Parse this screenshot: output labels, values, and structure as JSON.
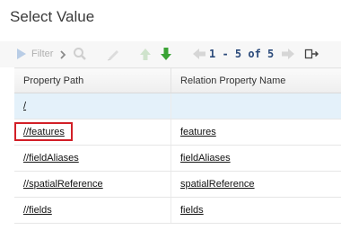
{
  "dialog": {
    "title": "Select Value"
  },
  "toolbar": {
    "filter_label": "Filter",
    "pager_text": "1 - 5 of 5",
    "icons": [
      "filter-icon",
      "chevron-right-icon",
      "search-icon",
      "edit-icon",
      "move-up-icon",
      "move-down-icon",
      "previous-page-icon",
      "next-page-icon",
      "export-icon"
    ]
  },
  "grid": {
    "columns": [
      "Property Path",
      "Relation Property Name"
    ],
    "rows": [
      {
        "path": "/",
        "name": ""
      },
      {
        "path": "//features",
        "name": "features"
      },
      {
        "path": "//fieldAliases",
        "name": "fieldAliases"
      },
      {
        "path": "//spatialReference",
        "name": "spatialReference"
      },
      {
        "path": "//fields",
        "name": "fields"
      }
    ]
  },
  "colors": {
    "highlight": "#d21f27",
    "selected_row": "#e4f1fa",
    "arrow_green": "#3aa335"
  }
}
